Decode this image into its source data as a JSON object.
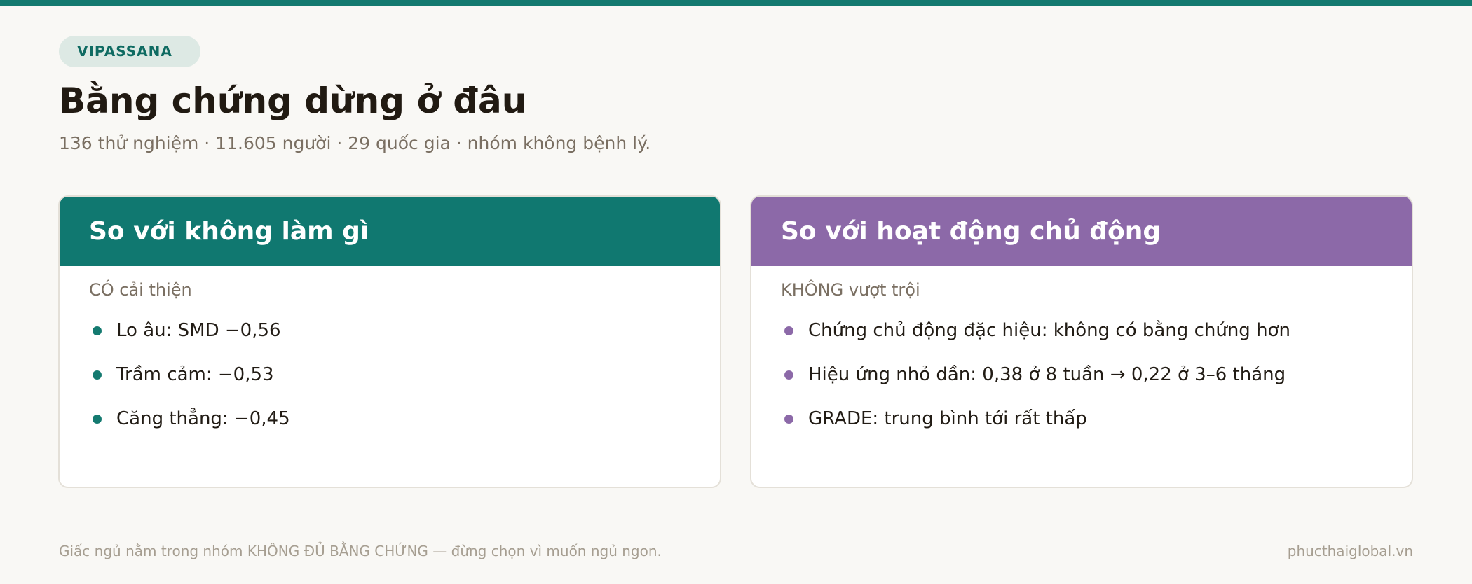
{
  "colors": {
    "accent_teal": "#107870",
    "accent_purple": "#8c69a8",
    "background": "#f9f8f5"
  },
  "tag": "VIPASSANA",
  "title": "Bằng chứng dừng ở đâu",
  "subtitle": "136 thử nghiệm · 11.605 người · 29 quốc gia · nhóm không bệnh lý.",
  "cards": [
    {
      "title": "So với không làm gì",
      "kicker": "CÓ cải thiện",
      "items": [
        "Lo âu: SMD −0,56",
        "Trầm cảm: −0,53",
        "Căng thẳng: −0,45"
      ]
    },
    {
      "title": "So với hoạt động chủ động",
      "kicker": "KHÔNG vượt trội",
      "items": [
        "Chứng chủ động đặc hiệu: không có bằng chứng hơn",
        "Hiệu ứng nhỏ dần: 0,38 ở 8 tuần → 0,22 ở 3–6 tháng",
        "GRADE: trung bình tới rất thấp"
      ]
    }
  ],
  "footer": {
    "note": "Giấc ngủ nằm trong nhóm KHÔNG ĐỦ BẰNG CHỨNG — đừng chọn vì muốn ngủ ngon.",
    "brand": "phucthaiglobal.vn"
  }
}
